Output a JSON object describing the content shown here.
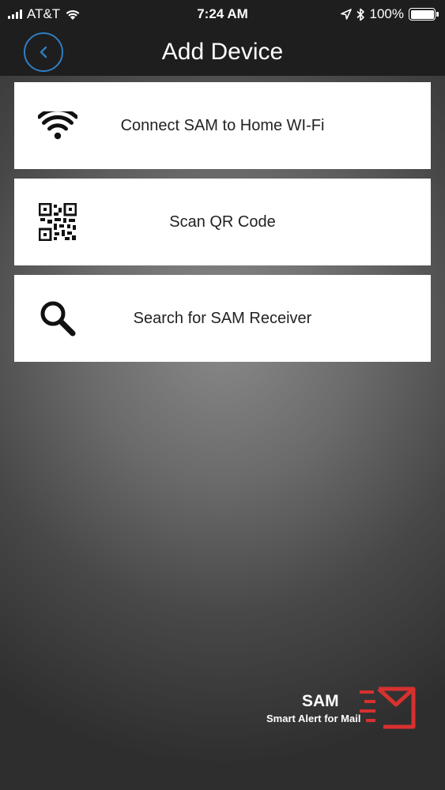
{
  "status_bar": {
    "carrier": "AT&T",
    "time": "7:24 AM",
    "battery": "100%",
    "icons": [
      "signal-icon",
      "wifi-icon",
      "location-icon",
      "bluetooth-icon",
      "battery-icon"
    ]
  },
  "nav": {
    "title": "Add Device",
    "back_icon": "chevron-left-icon"
  },
  "menu": [
    {
      "label": "Connect  SAM to Home WI-Fi",
      "icon": "wifi-icon"
    },
    {
      "label": "Scan QR Code",
      "icon": "qr-code-icon"
    },
    {
      "label": "Search for SAM Receiver",
      "icon": "search-icon"
    }
  ],
  "logo": {
    "name": "SAM",
    "tagline": "Smart Alert for Mail"
  },
  "colors": {
    "bar_background": "#1e1e1e",
    "accent": "#2f7ec2",
    "logo_red": "#d6312f"
  }
}
